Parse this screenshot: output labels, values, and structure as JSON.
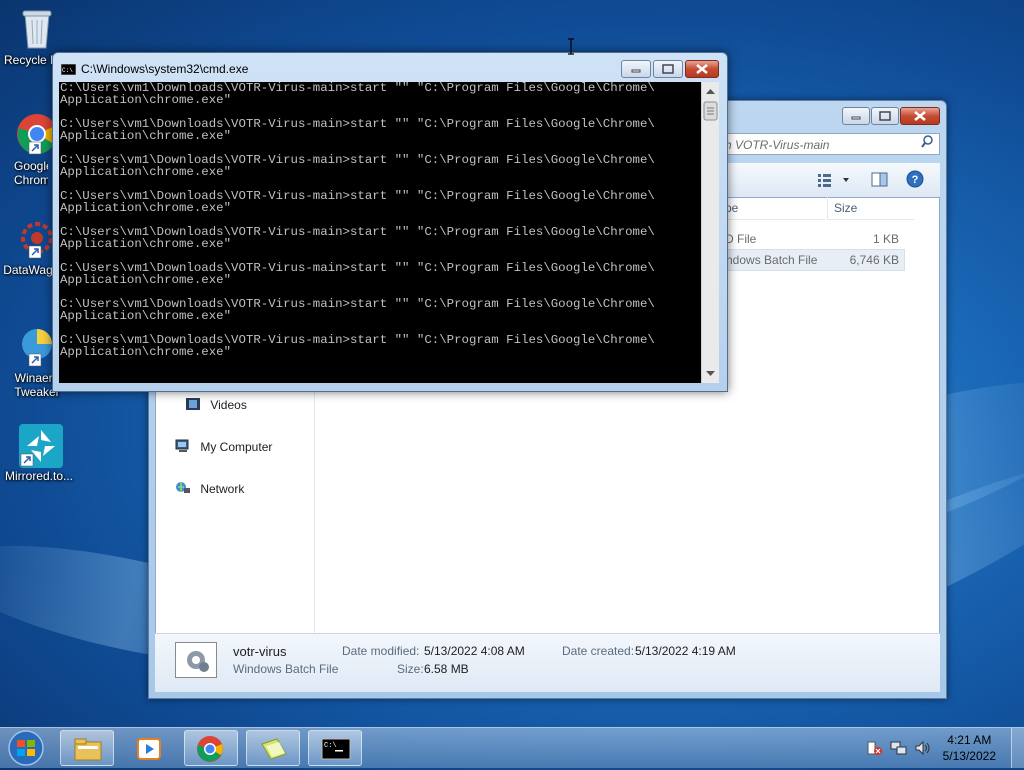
{
  "desktop": {
    "icons": [
      {
        "label": "Recycle Bin"
      },
      {
        "label": "Google Chrome"
      },
      {
        "label": "DataWag"
      },
      {
        "label": "Winaero Tweaker"
      },
      {
        "label": "Mirrored.to..."
      }
    ]
  },
  "explorer": {
    "search_placeholder": "ch VOTR-Virus-main",
    "columns": {
      "type": "pe",
      "size": "Size"
    },
    "files": [
      {
        "type": "D File",
        "size": "1 KB"
      },
      {
        "type": "ndows Batch File",
        "size": "6,746 KB"
      }
    ],
    "nav": [
      {
        "label": "Videos"
      },
      {
        "label": "My Computer"
      },
      {
        "label": "Network"
      }
    ],
    "details": {
      "name": "votr-virus",
      "kind": "Windows Batch File",
      "modified_label": "Date modified:",
      "modified_value": "5/13/2022 4:08 AM",
      "created_label": "Date created:",
      "created_value": "5/13/2022 4:19 AM",
      "size_label": "Size:",
      "size_value": "6.58 MB"
    }
  },
  "cmd": {
    "title": "C:\\Windows\\system32\\cmd.exe",
    "lines": [
      "C:\\Users\\vm1\\Downloads\\VOTR-Virus-main>start \"\" \"C:\\Program Files\\Google\\Chrome\\",
      "Application\\chrome.exe\"",
      "",
      "C:\\Users\\vm1\\Downloads\\VOTR-Virus-main>start \"\" \"C:\\Program Files\\Google\\Chrome\\",
      "Application\\chrome.exe\"",
      "",
      "C:\\Users\\vm1\\Downloads\\VOTR-Virus-main>start \"\" \"C:\\Program Files\\Google\\Chrome\\",
      "Application\\chrome.exe\"",
      "",
      "C:\\Users\\vm1\\Downloads\\VOTR-Virus-main>start \"\" \"C:\\Program Files\\Google\\Chrome\\",
      "Application\\chrome.exe\"",
      "",
      "C:\\Users\\vm1\\Downloads\\VOTR-Virus-main>start \"\" \"C:\\Program Files\\Google\\Chrome\\",
      "Application\\chrome.exe\"",
      "",
      "C:\\Users\\vm1\\Downloads\\VOTR-Virus-main>start \"\" \"C:\\Program Files\\Google\\Chrome\\",
      "Application\\chrome.exe\"",
      "",
      "C:\\Users\\vm1\\Downloads\\VOTR-Virus-main>start \"\" \"C:\\Program Files\\Google\\Chrome\\",
      "Application\\chrome.exe\"",
      "",
      "C:\\Users\\vm1\\Downloads\\VOTR-Virus-main>start \"\" \"C:\\Program Files\\Google\\Chrome\\",
      "Application\\chrome.exe\""
    ]
  },
  "taskbar": {
    "time": "4:21 AM",
    "date": "5/13/2022",
    "pinned": [
      "windows-explorer-icon",
      "media-player-icon",
      "chrome-icon",
      "file-folder-icon",
      "cmd-icon"
    ]
  }
}
